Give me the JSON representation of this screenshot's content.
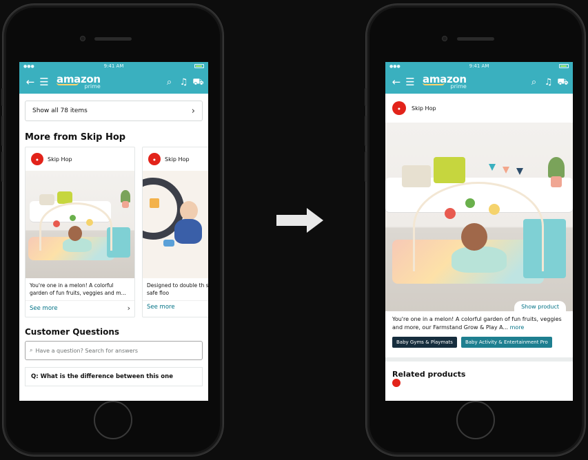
{
  "left": {
    "status_time": "9:41 AM",
    "nav": {
      "logo_text": "amazon",
      "logo_sub": "prime"
    },
    "show_all_label": "Show all 78 items",
    "section_title": "More from Skip Hop",
    "cards": [
      {
        "brand": "Skip Hop",
        "description": "You're one in a melon! A colorful garden of fun fruits, veggies and m…",
        "see_more": "See more"
      },
      {
        "brand": "Skip Hop",
        "description": "Designed to double th stylish, baby-safe floo",
        "see_more": "See more"
      }
    ],
    "questions_title": "Customer Questions",
    "questions_placeholder": "Have a question? Search for answers",
    "question_text": "Q: What is the difference between this one"
  },
  "right": {
    "status_time": "9:41 AM",
    "nav": {
      "logo_text": "amazon",
      "logo_sub": "prime"
    },
    "brand": "Skip Hop",
    "show_product_label": "Show product",
    "description": "You're one in a melon! A colorful garden of fun fruits, veggies and more, our Farmstand Grow & Play A...",
    "description_more": "more",
    "chips": [
      "Baby Gyms & Playmats",
      "Baby Activity & Entertainment Pro"
    ],
    "related_title": "Related products"
  },
  "colors": {
    "nav_teal": "#3ab0bf",
    "link": "#007185",
    "brand_red": "#e2231a",
    "chip_dark": "#162d3d",
    "chip_teal": "#1e7f90"
  },
  "icons": [
    "back-arrow-icon",
    "menu-icon",
    "search-icon",
    "bell-icon",
    "cart-icon",
    "chevron-right-icon",
    "transition-arrow-icon"
  ]
}
